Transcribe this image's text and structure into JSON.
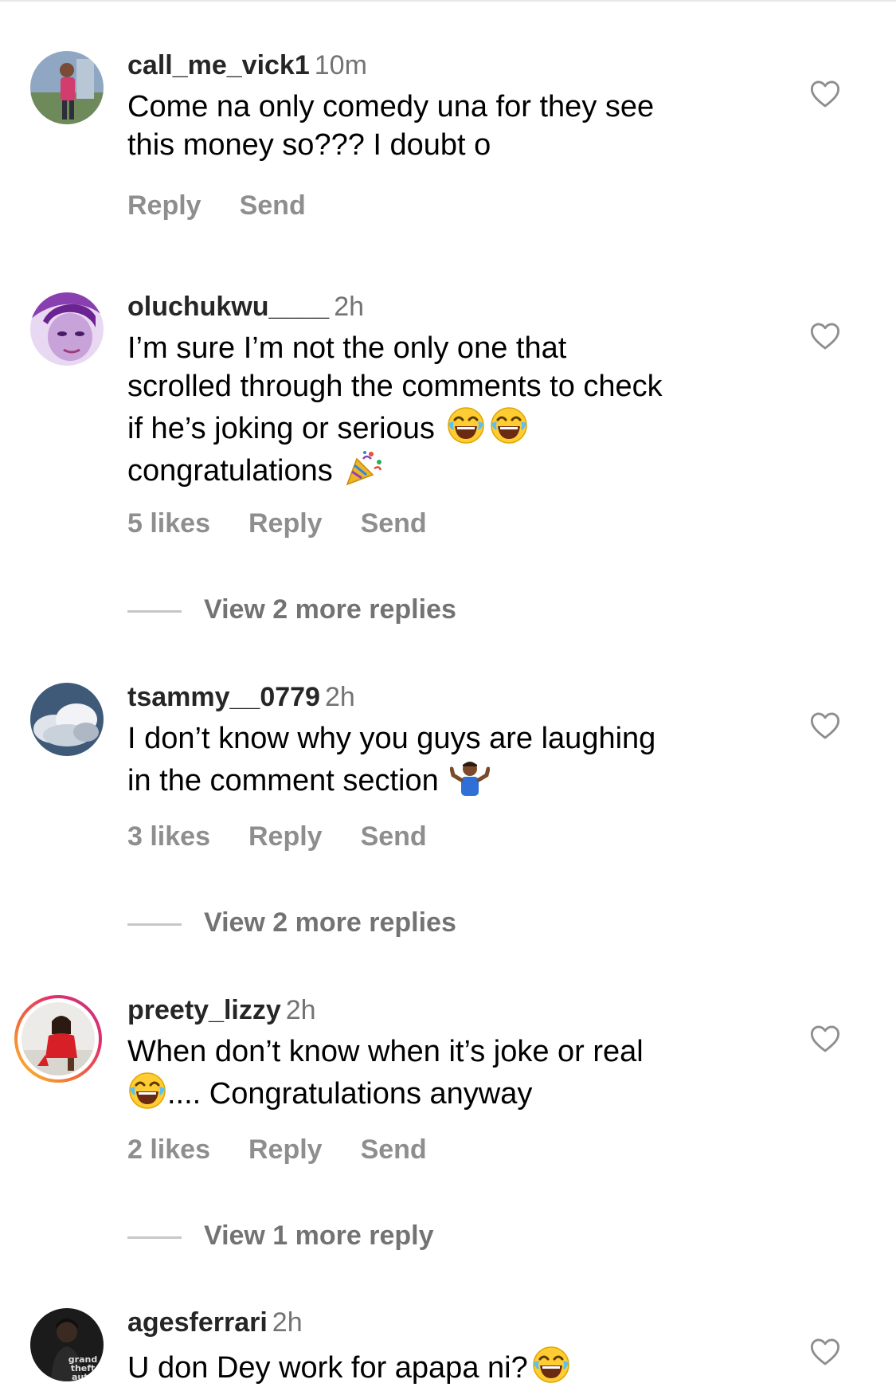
{
  "comments": [
    {
      "username": "call_me_vick1",
      "time": "10m",
      "text_lines": [
        "Come na only comedy una for they see",
        "this money so??? I doubt o"
      ],
      "likes": "",
      "reply_label": "Reply",
      "send_label": "Send"
    },
    {
      "username": "oluchukwu____",
      "time": "2h",
      "text_lines": [
        "I’m sure  I’m not the only one that",
        "scrolled through the comments to check",
        "if he’s joking or serious",
        "congratulations"
      ],
      "likes": "5 likes",
      "reply_label": "Reply",
      "send_label": "Send",
      "view_replies": "View 2 more replies"
    },
    {
      "username": "tsammy__0779",
      "time": "2h",
      "text_lines": [
        "I don’t know why you guys are laughing",
        "in the comment section"
      ],
      "likes": "3 likes",
      "reply_label": "Reply",
      "send_label": "Send",
      "view_replies": "View 2 more replies"
    },
    {
      "username": "preety_lizzy",
      "time": "2h",
      "text_lines": [
        "When don’t know when it’s joke or real",
        ".... Congratulations anyway"
      ],
      "likes": "2 likes",
      "reply_label": "Reply",
      "send_label": "Send",
      "view_replies": "View 1 more reply"
    },
    {
      "username": "agesferrari",
      "time": "2h",
      "text_lines": [
        "U don Dey work for apapa ni?"
      ],
      "avatar_text": [
        "grand",
        "theft",
        "auto"
      ]
    }
  ],
  "icons": {
    "heart": "heart-outline-icon",
    "laughing": "face-with-tears-of-joy-emoji",
    "party": "party-popper-emoji",
    "shrug": "person-shrugging-emoji"
  },
  "colors": {
    "username": "#262626",
    "time": "#737373",
    "action": "#8e8e8e",
    "story_ring": "#e1306c"
  }
}
